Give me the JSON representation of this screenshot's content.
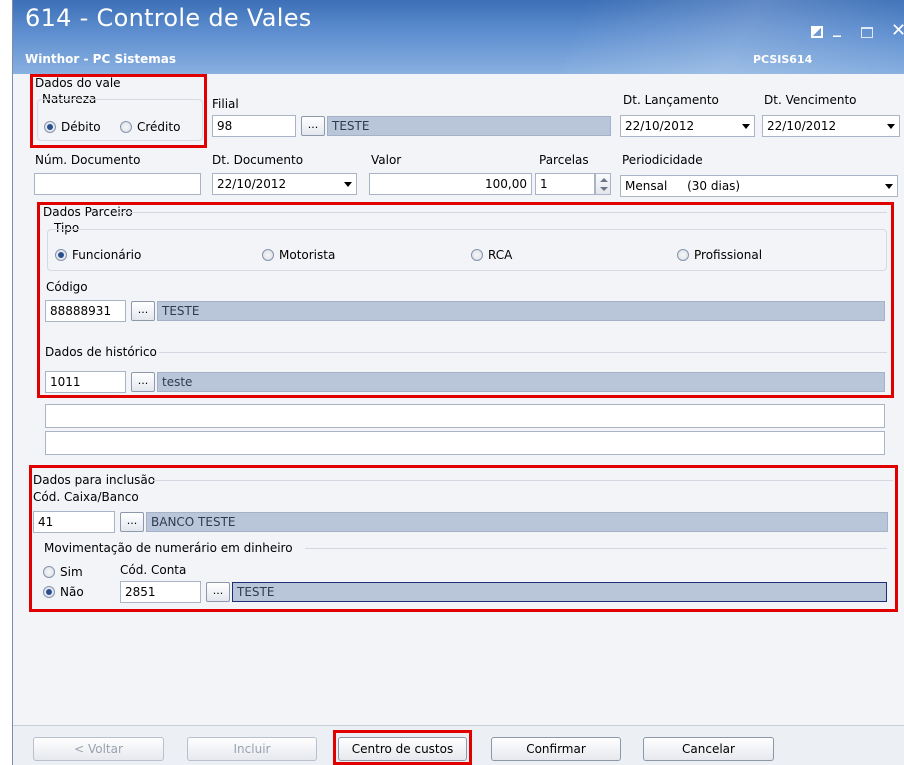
{
  "window": {
    "title": "614 - Controle de Vales",
    "subtitle": "Winthor - PC Sistemas",
    "code": "PCSIS614"
  },
  "dados_vale": {
    "group_label": "Dados do vale",
    "natureza_label": "Natureza",
    "debito_label": "Débito",
    "credito_label": "Crédito",
    "natureza_selected": "Débito"
  },
  "filial": {
    "label": "Filial",
    "value": "98",
    "desc": "TESTE"
  },
  "dt_lancamento": {
    "label": "Dt. Lançamento",
    "value": "22/10/2012"
  },
  "dt_vencimento": {
    "label": "Dt. Vencimento",
    "value": "22/10/2012"
  },
  "num_documento": {
    "label": "Núm. Documento",
    "value": ""
  },
  "dt_documento": {
    "label": "Dt. Documento",
    "value": "22/10/2012"
  },
  "valor": {
    "label": "Valor",
    "value": "100,00"
  },
  "parcelas": {
    "label": "Parcelas",
    "value": "1"
  },
  "periodicidade": {
    "label": "Periodicidade",
    "value": "Mensal",
    "detail": "(30 dias)"
  },
  "dados_parceiro": {
    "group_label": "Dados Parceiro",
    "tipo_label": "Tipo",
    "tipos": [
      "Funcionário",
      "Motorista",
      "RCA",
      "Profissional"
    ],
    "tipo_selected": "Funcionário",
    "codigo_label": "Código",
    "codigo_value": "88888931",
    "codigo_desc": "TESTE",
    "historico_label": "Dados de histórico",
    "historico_value": "1011",
    "historico_desc": "teste",
    "obs_line1": "",
    "obs_line2": ""
  },
  "dados_inclusao": {
    "group_label": "Dados para inclusão",
    "caixa_label": "Cód. Caixa/Banco",
    "caixa_value": "41",
    "caixa_desc": "BANCO TESTE",
    "mov_label": "Movimentação de numerário em dinheiro",
    "sim_label": "Sim",
    "nao_label": "Não",
    "mov_selected": "Não",
    "conta_label": "Cód. Conta",
    "conta_value": "2851",
    "conta_desc": "TESTE"
  },
  "dots_label": "...",
  "buttons": {
    "voltar": "< Voltar",
    "incluir": "Incluir",
    "centro_custos": "Centro de custos",
    "confirmar": "Confirmar",
    "cancelar": "Cancelar"
  },
  "colors": {
    "titlebar": "#3c6fb7",
    "highlight": "#e00000",
    "desc_field": "#b9c6d9"
  }
}
